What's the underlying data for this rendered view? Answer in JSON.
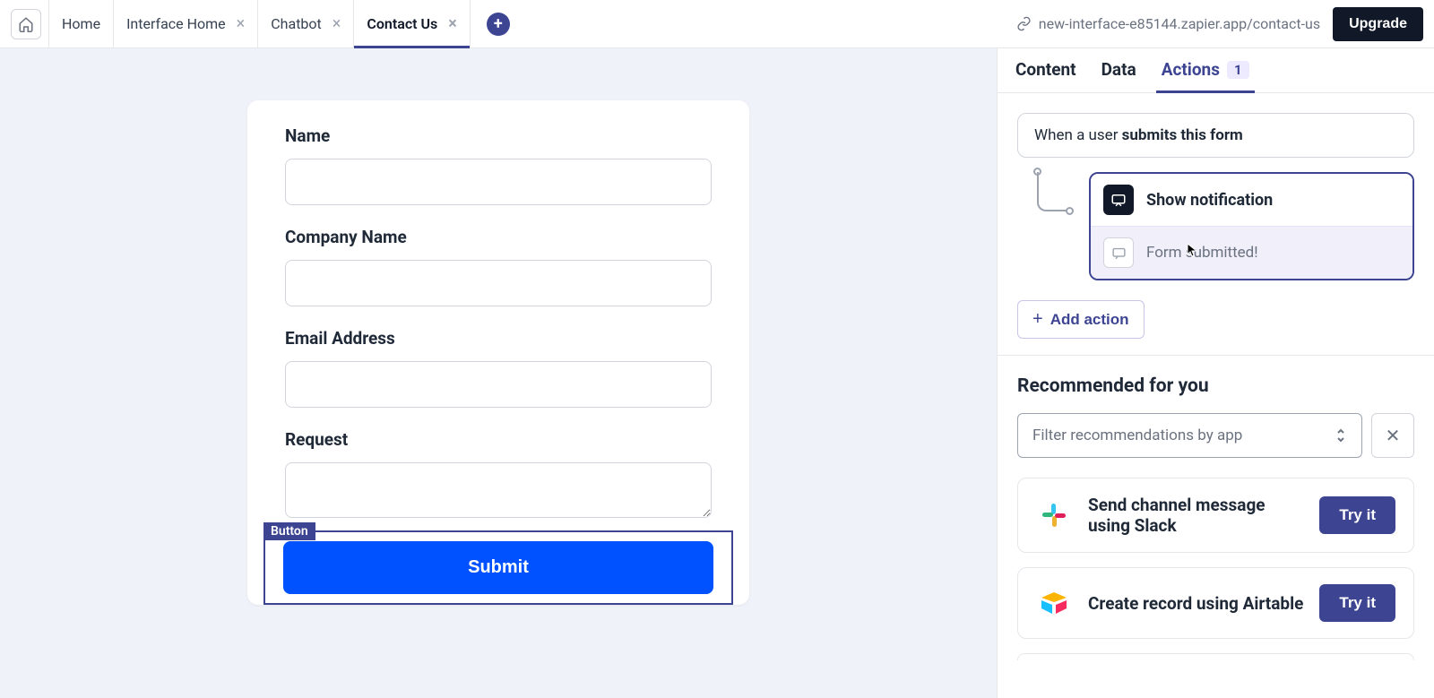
{
  "topbar": {
    "tabs": [
      {
        "label": "Home"
      },
      {
        "label": "Interface Home"
      },
      {
        "label": "Chatbot"
      },
      {
        "label": "Contact Us"
      }
    ],
    "url": "new-interface-e85144.zapier.app/contact-us",
    "upgrade": "Upgrade"
  },
  "form": {
    "fields": [
      {
        "label": "Name"
      },
      {
        "label": "Company Name"
      },
      {
        "label": "Email Address"
      },
      {
        "label": "Request"
      }
    ],
    "button_tag": "Button",
    "submit_label": "Submit"
  },
  "panel": {
    "tabs": {
      "content": "Content",
      "data": "Data",
      "actions": "Actions",
      "actions_count": "1"
    },
    "trigger_prefix": "When a user ",
    "trigger_bold": "submits this form",
    "action": {
      "title": "Show notification",
      "body": "Form submitted!"
    },
    "add_action": "Add action",
    "recommended_heading": "Recommended for you",
    "filter_placeholder": "Filter recommendations by app",
    "recs": [
      {
        "title": "Send channel message using Slack",
        "cta": "Try it"
      },
      {
        "title": "Create record using Airtable",
        "cta": "Try it"
      }
    ]
  }
}
